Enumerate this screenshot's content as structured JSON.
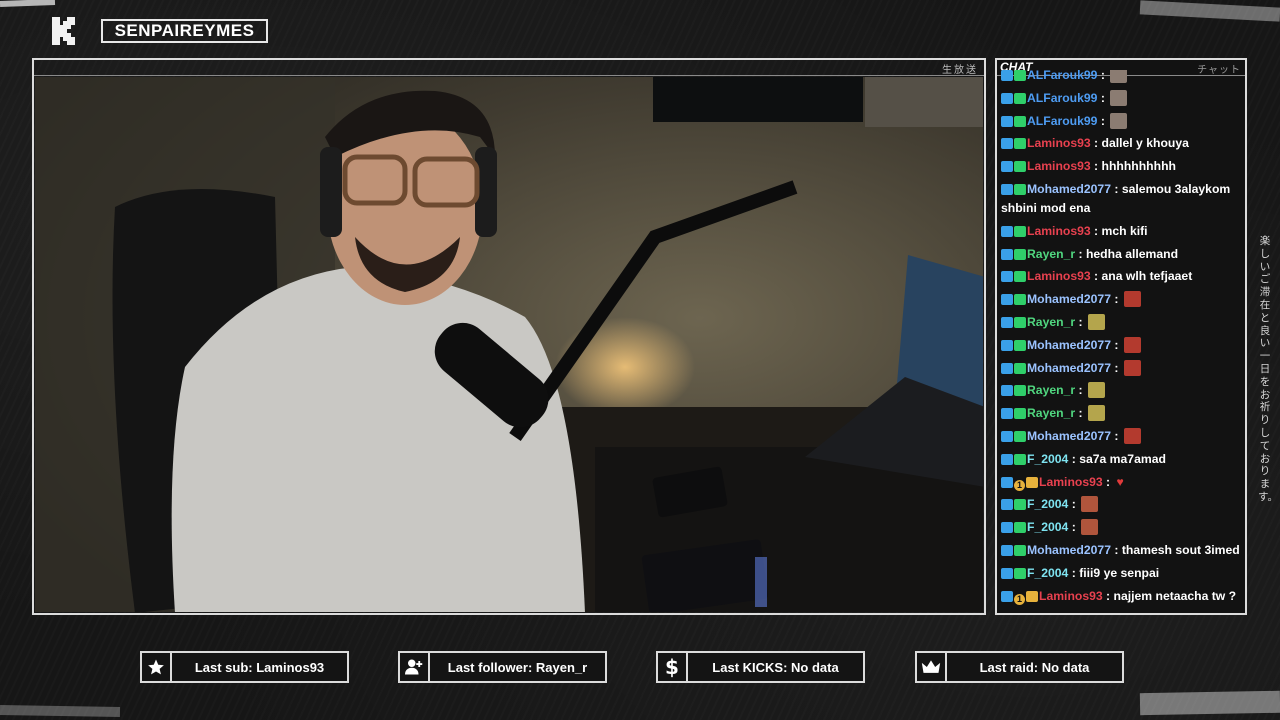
{
  "channel": {
    "name": "SENPAIREYMES"
  },
  "video": {
    "corner_label": "生放送"
  },
  "chat": {
    "title": "CHAT",
    "jp_label": "チャット",
    "messages": [
      {
        "user": "ALFarouk99",
        "color": "blue",
        "badges": [
          "a",
          "b"
        ],
        "text": "",
        "emote": "pic"
      },
      {
        "user": "ALFarouk99",
        "color": "blue",
        "badges": [
          "a",
          "b"
        ],
        "text": "",
        "emote": "pic"
      },
      {
        "user": "ALFarouk99",
        "color": "blue",
        "badges": [
          "a",
          "b"
        ],
        "text": "",
        "emote": "pic"
      },
      {
        "user": "Laminos93",
        "color": "red",
        "badges": [
          "a",
          "b"
        ],
        "text": "dallel y khouya"
      },
      {
        "user": "Laminos93",
        "color": "red",
        "badges": [
          "a",
          "b"
        ],
        "text": "hhhhhhhhhh"
      },
      {
        "user": "Mohamed2077",
        "color": "lightblue",
        "badges": [
          "a",
          "b"
        ],
        "text": "salemou 3alaykom shbini mod ena",
        "wrap": true
      },
      {
        "user": "Laminos93",
        "color": "red",
        "badges": [
          "a",
          "b"
        ],
        "text": "mch kifi"
      },
      {
        "user": "Rayen_r",
        "color": "green",
        "badges": [
          "a",
          "b"
        ],
        "text": "hedha allemand"
      },
      {
        "user": "Laminos93",
        "color": "red",
        "badges": [
          "a",
          "b"
        ],
        "text": "ana wlh tefjaaet"
      },
      {
        "user": "Mohamed2077",
        "color": "lightblue",
        "badges": [
          "a",
          "b"
        ],
        "text": "",
        "emote": "devil"
      },
      {
        "user": "Rayen_r",
        "color": "green",
        "badges": [
          "a",
          "b"
        ],
        "text": "",
        "emote": "pepe"
      },
      {
        "user": "Mohamed2077",
        "color": "lightblue",
        "badges": [
          "a",
          "b"
        ],
        "text": "",
        "emote": "devil"
      },
      {
        "user": "Mohamed2077",
        "color": "lightblue",
        "badges": [
          "a",
          "b"
        ],
        "text": "",
        "emote": "devil"
      },
      {
        "user": "Rayen_r",
        "color": "green",
        "badges": [
          "a",
          "b"
        ],
        "text": "",
        "emote": "pepe"
      },
      {
        "user": "Rayen_r",
        "color": "green",
        "badges": [
          "a",
          "b"
        ],
        "text": "",
        "emote": "pepe"
      },
      {
        "user": "Mohamed2077",
        "color": "lightblue",
        "badges": [
          "a",
          "b"
        ],
        "text": "",
        "emote": "devil"
      },
      {
        "user": "F_2004",
        "color": "cyan",
        "badges": [
          "a",
          "b"
        ],
        "text": "sa7a ma7amad"
      },
      {
        "user": "Laminos93",
        "color": "red",
        "badges": [
          "a",
          "c",
          "d"
        ],
        "text": "",
        "heart": true
      },
      {
        "user": "F_2004",
        "color": "cyan",
        "badges": [
          "a",
          "b"
        ],
        "text": "",
        "emote": "face"
      },
      {
        "user": "F_2004",
        "color": "cyan",
        "badges": [
          "a",
          "b"
        ],
        "text": "",
        "emote": "face"
      },
      {
        "user": "Mohamed2077",
        "color": "lightblue",
        "badges": [
          "a",
          "b"
        ],
        "text": "thamesh sout 3imed"
      },
      {
        "user": "F_2004",
        "color": "cyan",
        "badges": [
          "a",
          "b"
        ],
        "text": "fiii9 ye senpai"
      },
      {
        "user": "Laminos93",
        "color": "red",
        "badges": [
          "a",
          "c",
          "d"
        ],
        "text": "najjem netaacha tw ?"
      }
    ]
  },
  "side_text": "楽しいご滞在と良い一日をお祈りしております。",
  "stats": {
    "last_sub": "Last sub: Laminos93",
    "last_follower": "Last follower: Rayen_r",
    "last_kicks": "Last KICKS: No data",
    "last_raid": "Last raid: No data"
  },
  "icons": [
    "kick-logo-icon",
    "star-icon",
    "add-user-icon",
    "dollar-icon",
    "crown-icon"
  ],
  "colors": {
    "background": "#161616",
    "frame": "#dcdcdc",
    "name_blue": "#4e9cf2",
    "name_red": "#e8414f",
    "name_green": "#50d67f"
  }
}
